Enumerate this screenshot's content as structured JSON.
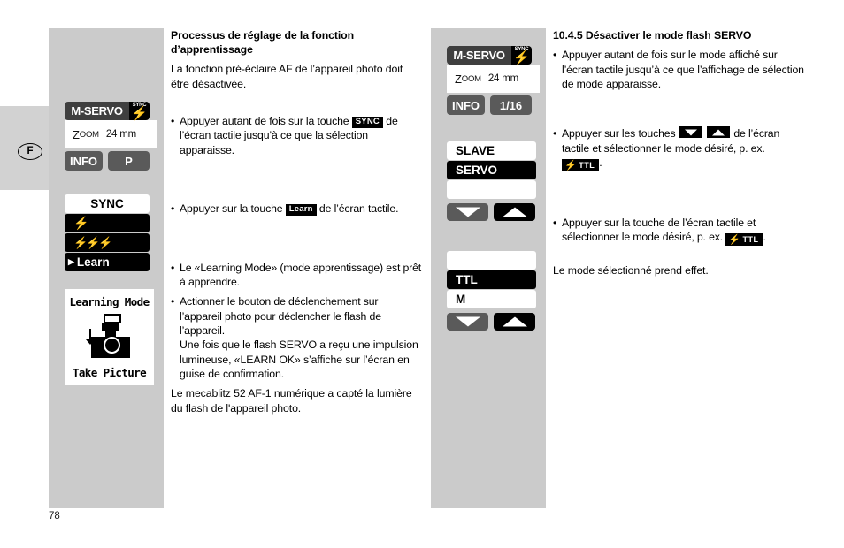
{
  "page": {
    "number": "78",
    "language_tab": "F"
  },
  "left_column": {
    "display1": {
      "mode_label": "M-SERVO",
      "sync_label": "SYNC",
      "sync_bolt_icon": "flash-bolt-icon",
      "zoom_label_first": "Z",
      "zoom_label_rest": "OOM",
      "zoom_value": "24 mm",
      "info_button": "INFO",
      "mode_button": "P"
    },
    "display2": {
      "header": "SYNC",
      "item_single_bolt_icon": "flash-bolt-icon",
      "item_multi_bolt_icon": "multi-flash-bolt-icon",
      "item_learn": "Learn",
      "learn_marker_icon": "right-arrow-marker-icon"
    },
    "display3": {
      "title": "Learning Mode",
      "art": "camera-with-flash-icon",
      "footer": "Take Picture"
    }
  },
  "text_left": {
    "heading": "Processus de réglage de la fonction d’apprentissage",
    "intro": "La fonction pré-éclaire AF de l’appareil photo doit être désactivée.",
    "bullet1_a": "Appuyer autant de fois sur la touche",
    "bullet1_badge": "SYNC",
    "bullet1_b": "de l’écran tactile jusqu’à ce que la sélection apparaisse.",
    "bullet2_a": "Appuyer sur la touche",
    "bullet2_badge": "Learn",
    "bullet2_b": "de l’écran tactile.",
    "bullet3": "Le «Learning Mode» (mode apprentissage) est prêt à apprendre.",
    "bullet4": "Actionner le bouton de déclenchement sur l’appareil photo pour déclencher le flash de l’appareil.",
    "bullet4_cont": "Une fois que le flash SERVO a reçu une impulsion lumineuse, «LEARN OK» s’affiche sur l’écran en guise de confirmation.",
    "closing": "Le mecablitz 52 AF-1 numérique a capté la lumière du flash de l'appareil photo."
  },
  "mid_column": {
    "display1": {
      "mode_label": "M-SERVO",
      "sync_label": "SYNC",
      "sync_bolt_icon": "flash-bolt-icon",
      "zoom_label_first": "Z",
      "zoom_label_rest": "OOM",
      "zoom_value": "24 mm",
      "info_button": "INFO",
      "power_button": "1/16"
    },
    "display2": {
      "item_slave": "SLAVE",
      "item_servo": "SERVO",
      "item_blank": "",
      "key_down_icon": "chevron-down-icon",
      "key_up_icon": "chevron-up-icon"
    },
    "display3": {
      "item_blank": "",
      "item_ttl": "TTL",
      "item_m": "M",
      "key_down_icon": "chevron-down-icon",
      "key_up_icon": "chevron-up-icon"
    }
  },
  "text_right": {
    "heading": "10.4.5 Désactiver le mode flash SERVO",
    "bullet1": "Appuyer autant de fois sur le mode affiché sur l’écran tactile jusqu’à ce que l’affichage de sélection de mode apparaisse.",
    "bullet2_a": "Appuyer sur les touches",
    "bullet2_arrow_down_icon": "arrow-down-key-icon",
    "bullet2_arrow_up_icon": "arrow-up-key-icon",
    "bullet2_b": "de l’écran tactile et sélectionner le mode désiré, p. ex.",
    "bullet2_badge_bolt_icon": "flash-bolt-icon",
    "bullet2_badge_text": "TTL",
    "bullet2_c": ".",
    "bullet3_a": "Appuyer sur la touche de l’écran tactile et sélectionner le mode désiré, p. ex.",
    "bullet3_badge_bolt_icon": "flash-bolt-icon",
    "bullet3_badge_text": "TTL",
    "bullet3_c": ".",
    "closing": "Le mode sélectionné prend effet."
  },
  "colors": {
    "panel_gray": "#cbcbcb",
    "tab_gray": "#d2d2d2",
    "lcd_dark": "#3f3f3f",
    "lcd_button": "#5a5a5a",
    "black": "#000000"
  }
}
